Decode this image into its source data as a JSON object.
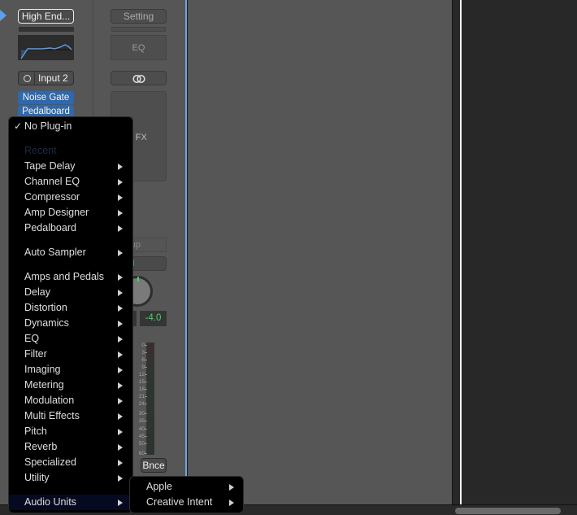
{
  "channel_strip_left": {
    "setting_button": "High End...",
    "input_button": "Input 2",
    "plugins": [
      "Noise Gate",
      "Pedalboard"
    ]
  },
  "channel_strip_right": {
    "setting_button": "Setting",
    "eq_label": "EQ",
    "link_icon": "stereo-link-icon",
    "audio_fx_label": "dio FX",
    "group_label": "roup",
    "automation_label": "ead",
    "volume_value": "-4.0",
    "meter_scale": [
      "0",
      "3",
      "6",
      "9",
      "12",
      "15",
      "18",
      "21",
      "24",
      "30",
      "35",
      "40",
      "45",
      "50",
      "60"
    ],
    "bounce_button": "Bnce"
  },
  "plugin_menu": {
    "items": [
      {
        "label": "No Plug-in",
        "checked": true,
        "submenu": false
      },
      {
        "label": "Recent",
        "header": true
      },
      {
        "label": "Tape Delay",
        "submenu": true
      },
      {
        "label": "Channel EQ",
        "submenu": true
      },
      {
        "label": "Compressor",
        "submenu": true
      },
      {
        "label": "Amp Designer",
        "submenu": true
      },
      {
        "label": "Pedalboard",
        "submenu": true
      },
      {
        "label": "Auto Sampler",
        "submenu": true
      },
      {
        "label": "Amps and Pedals",
        "submenu": true
      },
      {
        "label": "Delay",
        "submenu": true
      },
      {
        "label": "Distortion",
        "submenu": true
      },
      {
        "label": "Dynamics",
        "submenu": true
      },
      {
        "label": "EQ",
        "submenu": true
      },
      {
        "label": "Filter",
        "submenu": true
      },
      {
        "label": "Imaging",
        "submenu": true
      },
      {
        "label": "Metering",
        "submenu": true
      },
      {
        "label": "Modulation",
        "submenu": true
      },
      {
        "label": "Multi Effects",
        "submenu": true
      },
      {
        "label": "Pitch",
        "submenu": true
      },
      {
        "label": "Reverb",
        "submenu": true
      },
      {
        "label": "Specialized",
        "submenu": true
      },
      {
        "label": "Utility",
        "submenu": true
      },
      {
        "label": "Audio Units",
        "submenu": true,
        "highlighted": true
      }
    ]
  },
  "audio_units_submenu": {
    "items": [
      {
        "label": "Apple",
        "submenu": true
      },
      {
        "label": "Creative Intent",
        "submenu": true
      }
    ]
  },
  "colors": {
    "accent_blue": "#2f68ab",
    "selection_line": "#6fa4e6",
    "value_green": "#46d163"
  }
}
